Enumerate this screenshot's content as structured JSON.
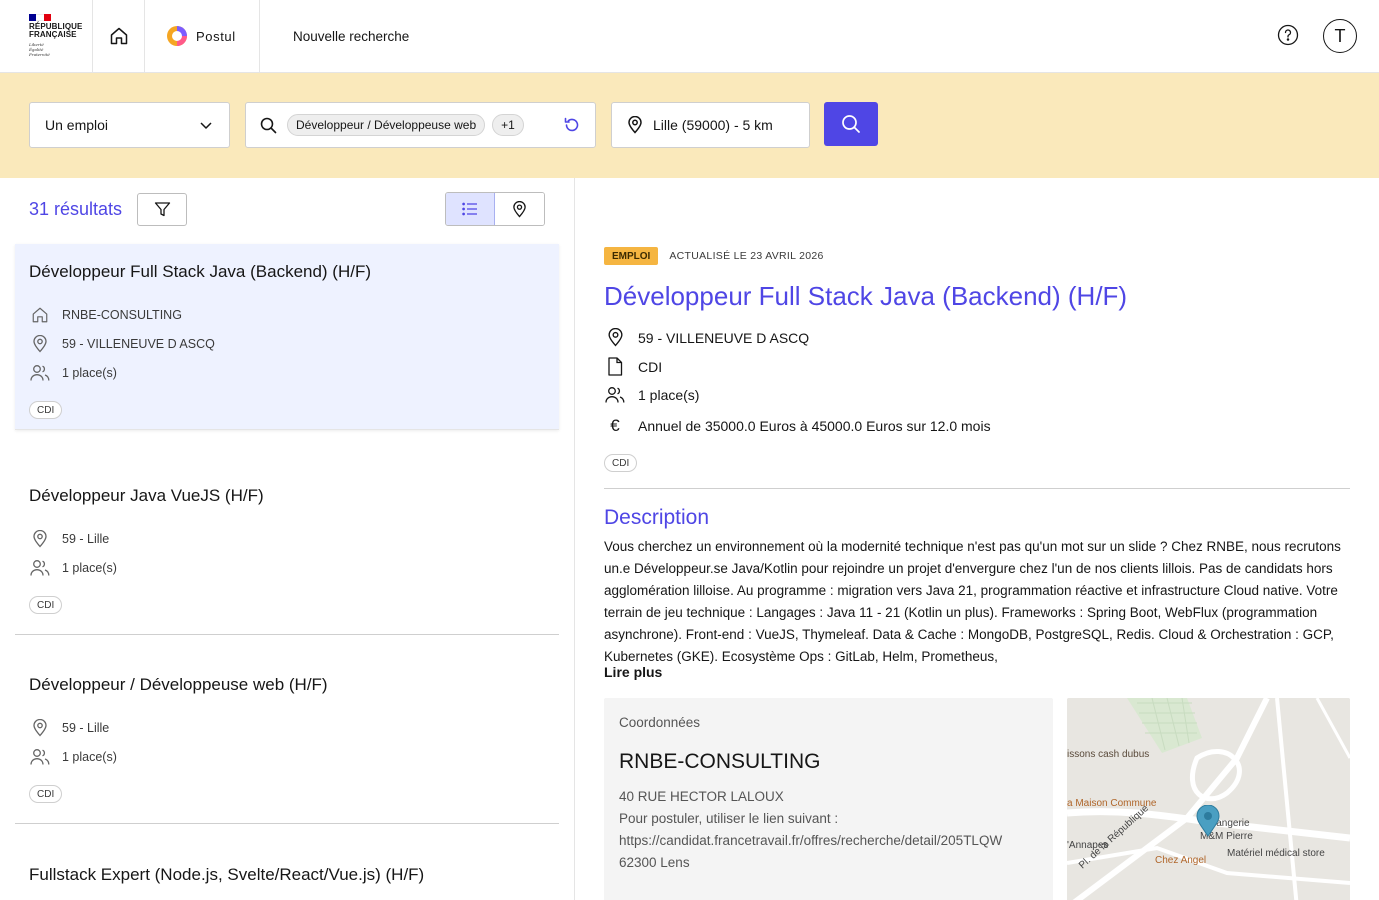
{
  "header": {
    "republique": "RÉPUBLIQUE\nFRANÇAISE",
    "motto": "Liberté\nÉgalité\nFraternité",
    "brand": "Postul",
    "nav_new_search": "Nouvelle recherche",
    "avatar_initial": "T",
    "flag_colors": [
      "#000091",
      "#ffffff",
      "#e1000f"
    ]
  },
  "search": {
    "type_value": "Un emploi",
    "keyword_chip": "Développeur / Développeuse web",
    "keyword_more": "+1",
    "location": "Lille (59000) - 5 km"
  },
  "results": {
    "count_label": "31 résultats",
    "items": [
      {
        "title": "Développeur Full Stack Java (Backend) (H/F)",
        "company": "RNBE-CONSULTING",
        "location": "59 - VILLENEUVE D ASCQ",
        "places": "1 place(s)",
        "contract": "CDI"
      },
      {
        "title": "Développeur Java VueJS (H/F)",
        "location": "59 - Lille",
        "places": "1 place(s)",
        "contract": "CDI"
      },
      {
        "title": "Développeur / Développeuse web (H/F)",
        "location": "59 - Lille",
        "places": "1 place(s)",
        "contract": "CDI"
      },
      {
        "title": "Fullstack Expert (Node.js, Svelte/React/Vue.js) (H/F)"
      }
    ]
  },
  "detail": {
    "tag": "EMPLOI",
    "updated": "ACTUALISÉ LE 23 AVRIL 2026",
    "title": "Développeur Full Stack Java (Backend) (H/F)",
    "location": "59 - VILLENEUVE D ASCQ",
    "contract_type": "CDI",
    "places": "1 place(s)",
    "salary": "Annuel de 35000.0 Euros à 45000.0 Euros sur 12.0 mois",
    "badge": "CDI",
    "description_title": "Description",
    "description": "Vous cherchez un environnement où la modernité technique n'est pas qu'un mot sur un slide ? Chez RNBE, nous recrutons un.e Développeur.se Java/Kotlin pour rejoindre un projet d'envergure chez l'un de nos clients lillois. Pas de candidats hors agglomération lilloise. Au programme : migration vers Java 21, programmation réactive et infrastructure Cloud native. Votre terrain de jeu technique : Langages : Java 11 - 21 (Kotlin un plus). Frameworks : Spring Boot, WebFlux (programmation asynchrone). Front-end : VueJS, Thymeleaf. Data & Cache : MongoDB, PostgreSQL, Redis. Cloud & Orchestration : GCP, Kubernetes (GKE). Ecosystème Ops : GitLab, Helm, Prometheus,",
    "read_more": "Lire plus",
    "contact": {
      "label": "Coordonnées",
      "company": "RNBE-CONSULTING",
      "address": "40 RUE HECTOR LALOUX",
      "apply_text": "Pour postuler, utiliser le lien suivant :",
      "url": "https://candidat.francetravail.fr/offres/recherche/detail/205TLQW",
      "city": "62300 Lens"
    },
    "map_labels": {
      "l1": "issons cash dubus",
      "l2": "a Maison Commune",
      "l3": "langerie",
      "l4": "M&M Pierre",
      "l5": "'Annapes",
      "l6": "Chez Angel",
      "l7": "Matériel médical store",
      "l8": "Pl. de la République"
    }
  },
  "colors": {
    "accent": "#4f46e5",
    "search_band": "#fae9bb",
    "selected_card": "#eef2ff",
    "tag_emploi": "#f5b541"
  }
}
